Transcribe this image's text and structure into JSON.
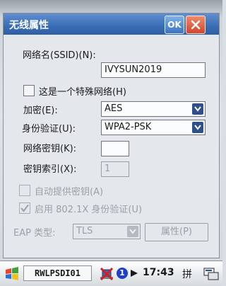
{
  "dialog": {
    "title": "无线属性",
    "ok_label": "OK",
    "close_icon": "close-icon"
  },
  "ssid": {
    "label": "网络名(SSID)(N):",
    "value": "IVYSUN2019"
  },
  "adhoc": {
    "label": "这是一个特殊网络(H)",
    "checked": false
  },
  "encryption": {
    "label": "加密(E):",
    "value": "AES"
  },
  "auth": {
    "label": "身份验证(U):",
    "value": "WPA2-PSK"
  },
  "network_key": {
    "label": "网络密钥(K):",
    "value": ""
  },
  "key_index": {
    "label": "密钥索引(X):",
    "value": "1"
  },
  "auto_key": {
    "label": "自动提供密钥(A)",
    "checked": false,
    "enabled": false
  },
  "dot1x": {
    "label": "启用 802.1X 身份验证(U)",
    "checked": true,
    "enabled": false
  },
  "eap": {
    "label": "EAP 类型:",
    "value": "TLS",
    "properties_label": "属性(P)"
  },
  "taskbar": {
    "task_label": "RWLPSDI01",
    "tray_number": "1",
    "time": "17:43",
    "ime_label": "拼"
  },
  "colors": {
    "title_bar": "#3a6db5",
    "close_button": "#d2452a",
    "combo_arrow": "#2f4f8a"
  }
}
